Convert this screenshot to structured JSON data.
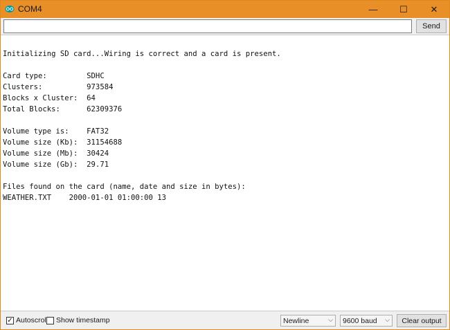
{
  "window": {
    "title": "COM4",
    "accent": "#e98f28",
    "minimize_icon": "minimize-icon",
    "maximize_icon": "maximize-icon",
    "close_icon": "close-icon",
    "minimize_glyph": "—",
    "maximize_glyph": "☐",
    "close_glyph": "✕"
  },
  "send_bar": {
    "input_value": "",
    "send_label": "Send"
  },
  "output": {
    "lines": [
      "Initializing SD card...Wiring is correct and a card is present.",
      "",
      "Card type:         SDHC",
      "Clusters:          973584",
      "Blocks x Cluster:  64",
      "Total Blocks:      62309376",
      "",
      "Volume type is:    FAT32",
      "Volume size (Kb):  31154688",
      "Volume size (Mb):  30424",
      "Volume size (Gb):  29.71",
      "",
      "Files found on the card (name, date and size in bytes):",
      "WEATHER.TXT    2000-01-01 01:00:00 13"
    ]
  },
  "status_bar": {
    "autoscroll_label": "Autoscroll",
    "autoscroll_checked": true,
    "autoscroll_mark": "✓",
    "timestamp_label": "Show timestamp",
    "timestamp_checked": false,
    "line_ending": "Newline",
    "baud_rate": "9600 baud",
    "clear_label": "Clear output",
    "dropdown_glyph": "⌵"
  }
}
